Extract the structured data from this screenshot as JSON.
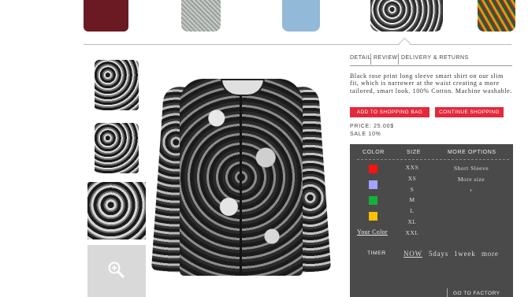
{
  "tabs": {
    "detail": "DETAIL",
    "review": "REVIEW",
    "delivery": "DELIVERY & RETURNS"
  },
  "product": {
    "description": "Black rose print long sleeve smart shirt on our slim fit, which is narrower at the waist creating a more tailored, smart look. 100% Cotton. Machine washable.",
    "price": "PRICE: 25.00$",
    "sale": "SALE 10%"
  },
  "buttons": {
    "add_to_bag": "ADD TO SHOPPING BAG",
    "continue": "CONTINUE SHOPPING"
  },
  "options": {
    "headers": {
      "color": "COLOR",
      "size": "SIZE",
      "more": "MORE OPTIONS"
    },
    "colors": [
      "#ff1111",
      "#a3a3ff",
      "#14b13a",
      "#ffc000"
    ],
    "your_color": "Your Color",
    "sizes": [
      "XXS",
      "XS",
      "S",
      "M",
      "L",
      "XL",
      "XXL"
    ],
    "more": [
      "Short Sleeve",
      "More size",
      "+"
    ],
    "timer_label": "TIMER",
    "timer_options": [
      "NOW",
      "5days",
      "1week",
      "more"
    ],
    "factory": "GO TO FACTORY"
  },
  "icons": {
    "zoom": "zoom-in-icon"
  }
}
